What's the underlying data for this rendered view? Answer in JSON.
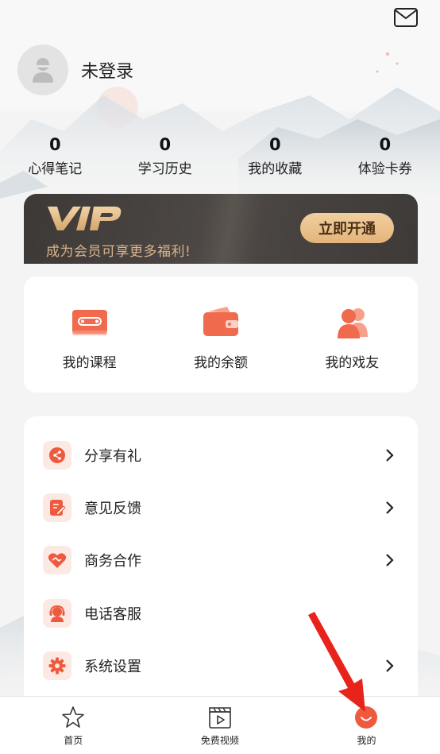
{
  "profile": {
    "login_status": "未登录"
  },
  "stats": [
    {
      "value": "0",
      "label": "心得笔记"
    },
    {
      "value": "0",
      "label": "学习历史"
    },
    {
      "value": "0",
      "label": "我的收藏"
    },
    {
      "value": "0",
      "label": "体验卡券"
    }
  ],
  "vip": {
    "subtitle": "成为会员可享更多福利!",
    "button": "立即开通"
  },
  "quick": [
    {
      "label": "我的课程",
      "icon": "cassette-icon"
    },
    {
      "label": "我的余额",
      "icon": "wallet-icon"
    },
    {
      "label": "我的戏友",
      "icon": "friends-icon"
    }
  ],
  "menu": [
    {
      "label": "分享有礼",
      "icon": "share-icon",
      "arrow": true
    },
    {
      "label": "意见反馈",
      "icon": "feedback-icon",
      "arrow": true
    },
    {
      "label": "商务合作",
      "icon": "handshake-icon",
      "arrow": true
    },
    {
      "label": "电话客服",
      "icon": "headset-icon",
      "arrow": false
    },
    {
      "label": "系统设置",
      "icon": "gear-icon",
      "arrow": true
    }
  ],
  "tabs": [
    {
      "label": "首页",
      "icon": "star-icon"
    },
    {
      "label": "免费视频",
      "icon": "video-icon"
    },
    {
      "label": "我的",
      "icon": "profile-face-icon",
      "active": true
    }
  ],
  "colors": {
    "accent": "#ee5a3e",
    "vip_gold": "#e3b47b",
    "vip_dark": "#3e3a38",
    "page_bg": "#f4f4f4"
  }
}
